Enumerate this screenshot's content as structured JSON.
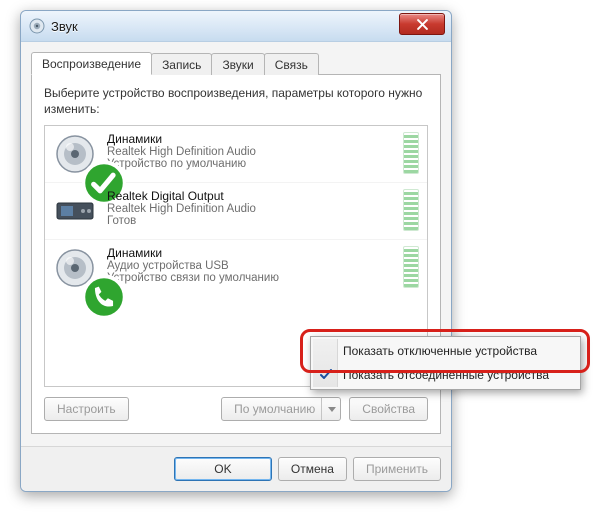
{
  "window": {
    "title": "Звук",
    "close_btn": "Закрыть"
  },
  "tabs": {
    "playback": "Воспроизведение",
    "record": "Запись",
    "sounds": "Звуки",
    "comm": "Связь"
  },
  "instruction": "Выберите устройство воспроизведения, параметры которого нужно изменить:",
  "devices": [
    {
      "name": "Динамики",
      "sub1": "Realtek High Definition Audio",
      "sub2": "Устройство по умолчанию",
      "icon": "speaker",
      "badge": "check-green"
    },
    {
      "name": "Realtek Digital Output",
      "sub1": "Realtek High Definition Audio",
      "sub2": "Готов",
      "icon": "digital-out",
      "badge": null
    },
    {
      "name": "Динамики",
      "sub1": "Аудио устройства USB",
      "sub2": "Устройство связи по умолчанию",
      "icon": "speaker",
      "badge": "phone-green"
    }
  ],
  "panel_buttons": {
    "configure": "Настроить",
    "default": "По умолчанию",
    "props": "Свойства"
  },
  "dlg_buttons": {
    "ok": "OK",
    "cancel": "Отмена",
    "apply": "Применить"
  },
  "context_menu": {
    "show_disabled": "Показать отключенные устройства",
    "show_disconnected": "Показать отсоединенные устройства",
    "show_disabled_checked": false,
    "show_disconnected_checked": true
  },
  "colors": {
    "highlight": "#d7201a",
    "accent": "#2e74b5"
  }
}
